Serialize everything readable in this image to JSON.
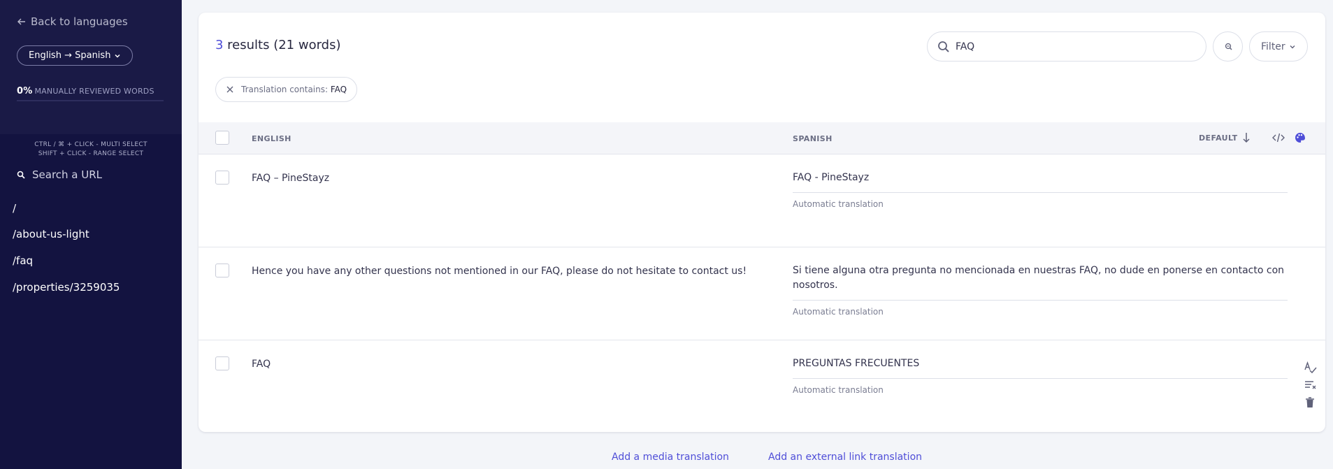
{
  "sidebar": {
    "back_label": "Back to languages",
    "language_pair": "English → Spanish",
    "reviewed_percent": "0%",
    "reviewed_label": "MANUALLY REVIEWED WORDS",
    "reviewed_fraction": 0,
    "hint_multi": "CTRL / ⌘ + CLICK - MULTI SELECT",
    "hint_range": "SHIFT + CLICK - RANGE SELECT",
    "search_placeholder": "Search a URL",
    "urls": [
      "/",
      "/about-us-light",
      "/faq",
      "/properties/3259035"
    ]
  },
  "header": {
    "results_count": "3",
    "results_text": " results (21 words)",
    "search_value": "FAQ",
    "filter_label": "Filter"
  },
  "chip": {
    "label": "Translation contains: ",
    "value": "FAQ"
  },
  "table": {
    "col_source": "ENGLISH",
    "col_target": "SPANISH",
    "col_sort": "DEFAULT",
    "rows": [
      {
        "source": "FAQ – PineStayz",
        "target": "FAQ - PineStayz",
        "status": "Automatic translation"
      },
      {
        "source": "Hence you have any other questions not mentioned in our FAQ, please do not hesitate to contact us!",
        "target": "Si tiene alguna otra pregunta no mencionada en nuestras FAQ, no dude en ponerse en contacto con nosotros.",
        "status": "Automatic translation"
      },
      {
        "source": "FAQ",
        "target": "PREGUNTAS FRECUENTES",
        "status": "Automatic translation"
      }
    ]
  },
  "footer": {
    "media_link": "Add a media translation",
    "external_link": "Add an external link translation"
  },
  "colors": {
    "sidebar_bg": "#131340",
    "accent": "#4f4ed8",
    "card_bg": "#ffffff"
  }
}
